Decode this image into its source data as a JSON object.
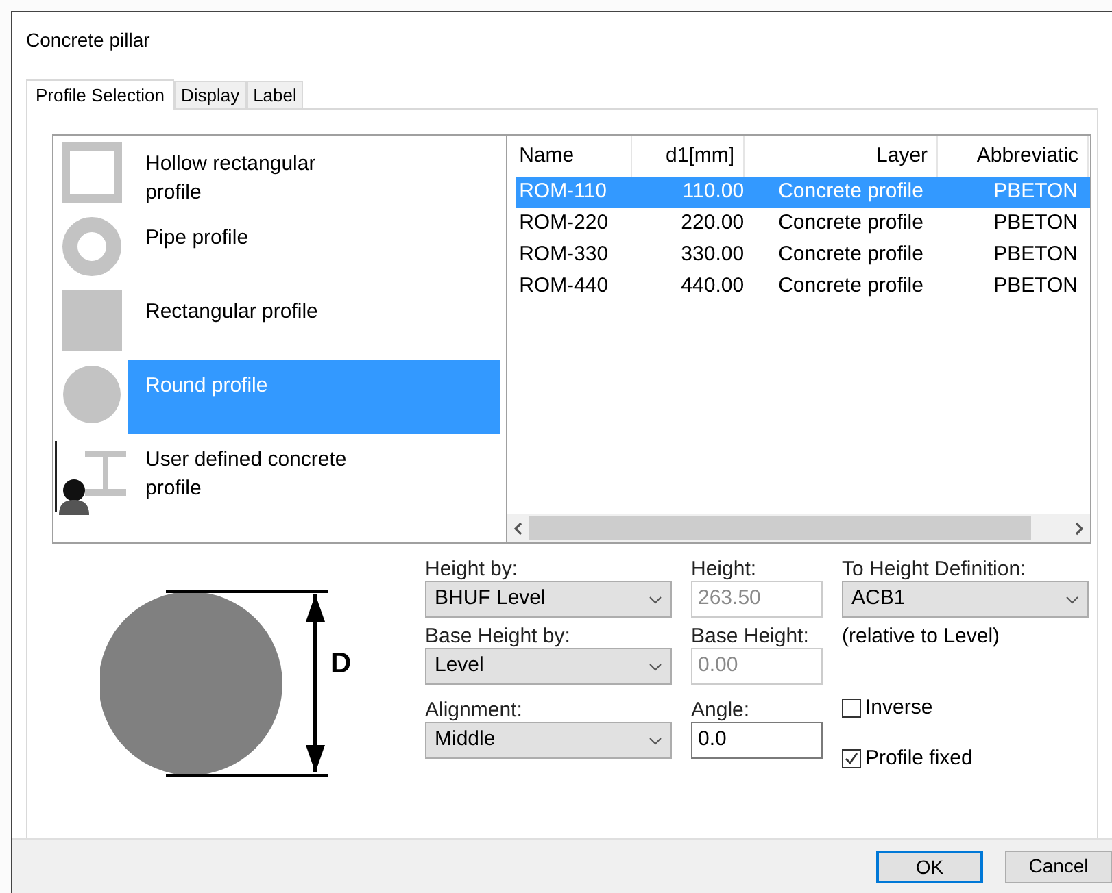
{
  "window": {
    "title": "Concrete pillar"
  },
  "tabs": [
    {
      "label": "Profile Selection",
      "selected": true
    },
    {
      "label": "Display",
      "selected": false
    },
    {
      "label": "Label",
      "selected": false
    }
  ],
  "profile_types": [
    {
      "kind": "hollow-rect",
      "label": "Hollow rectangular profile",
      "selected": false
    },
    {
      "kind": "pipe",
      "label": "Pipe profile",
      "selected": false
    },
    {
      "kind": "rect",
      "label": "Rectangular profile",
      "selected": false
    },
    {
      "kind": "round",
      "label": "Round profile",
      "selected": true
    },
    {
      "kind": "user",
      "label": "User defined concrete profile",
      "selected": false
    }
  ],
  "table": {
    "columns": [
      "Name",
      "d1[mm]",
      "Layer",
      "Abbreviatic"
    ],
    "rows": [
      {
        "cells": [
          "ROM-110",
          "110.00",
          "Concrete profile",
          "PBETON"
        ],
        "selected": true
      },
      {
        "cells": [
          "ROM-220",
          "220.00",
          "Concrete profile",
          "PBETON"
        ],
        "selected": false
      },
      {
        "cells": [
          "ROM-330",
          "330.00",
          "Concrete profile",
          "PBETON"
        ],
        "selected": false
      },
      {
        "cells": [
          "ROM-440",
          "440.00",
          "Concrete profile",
          "PBETON"
        ],
        "selected": false
      }
    ]
  },
  "diagram": {
    "label": "D"
  },
  "form": {
    "height_by": {
      "label": "Height by:",
      "value": "BHUF Level"
    },
    "height": {
      "label": "Height:",
      "value": "263.50",
      "disabled": true
    },
    "to_height_definition": {
      "label": "To Height Definition:",
      "value": "ACB1"
    },
    "base_height_by": {
      "label": "Base Height by:",
      "value": "Level"
    },
    "base_height": {
      "label": "Base Height:",
      "value": "0.00",
      "disabled": true
    },
    "relative_note": "(relative to Level)",
    "alignment": {
      "label": "Alignment:",
      "value": "Middle"
    },
    "angle": {
      "label": "Angle:",
      "value": "0.0",
      "disabled": false
    }
  },
  "checkboxes": [
    {
      "label": "Inverse",
      "checked": false
    },
    {
      "label": "Profile fixed",
      "checked": true
    }
  ],
  "buttons": [
    {
      "label": "OK",
      "default": true
    },
    {
      "label": "Cancel",
      "default": false
    }
  ]
}
